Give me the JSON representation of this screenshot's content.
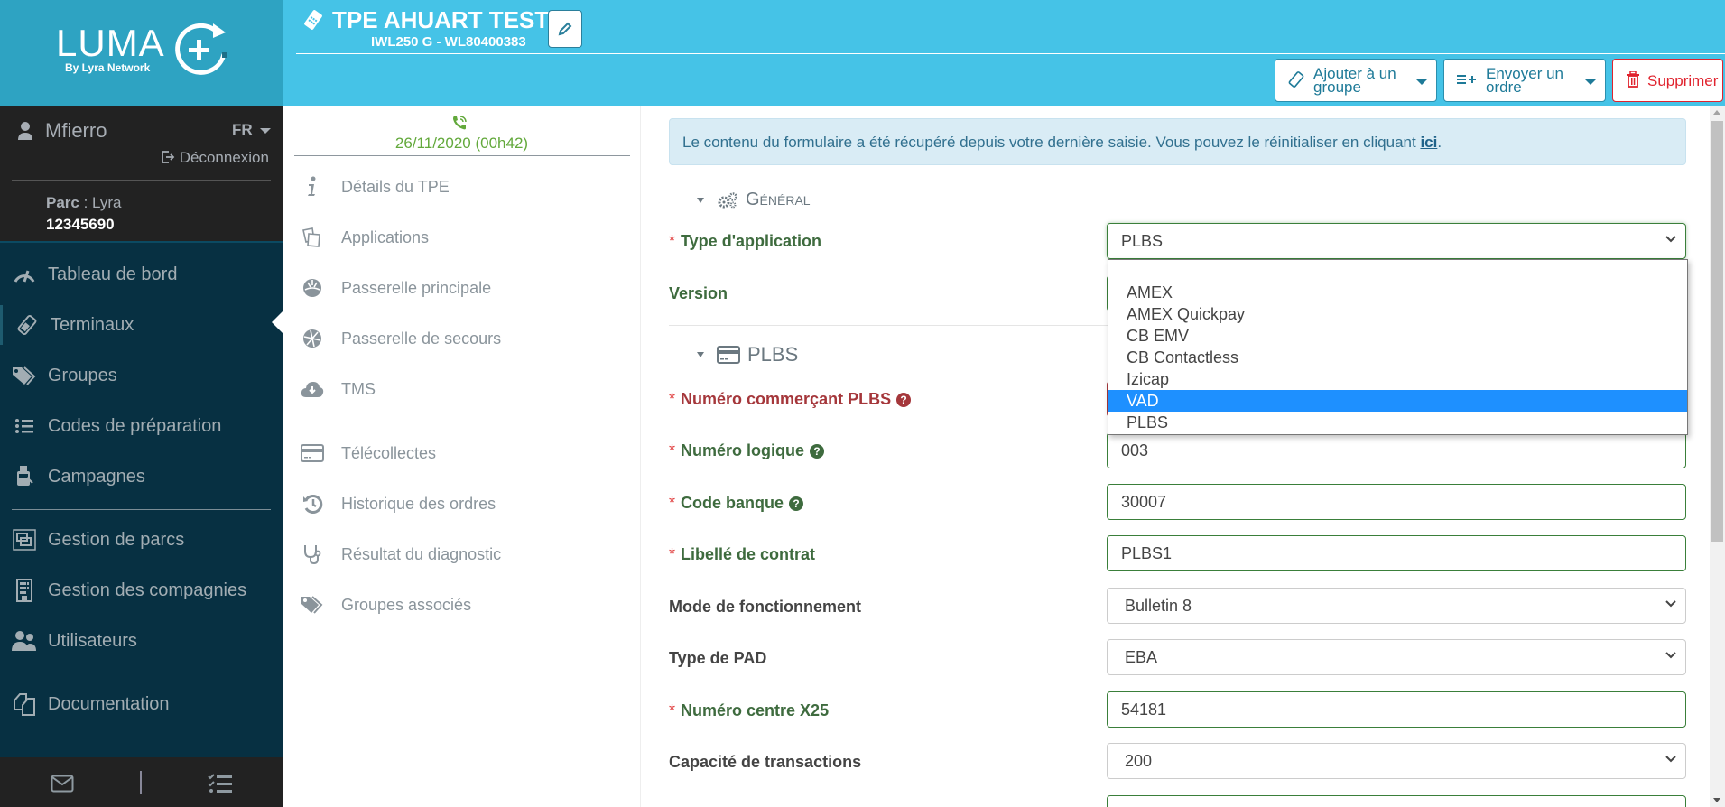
{
  "brand": {
    "name": "LUMA",
    "tagline": "By Lyra Network"
  },
  "user": {
    "name": "Mfierro",
    "language": "FR",
    "logout_label": "Déconnexion",
    "parc_label": "Parc",
    "parc_name": " : Lyra",
    "parc_id": "12345690"
  },
  "sidebar": {
    "items": [
      {
        "label": "Tableau de bord",
        "icon": "dashboard-gauge-icon"
      },
      {
        "label": "Terminaux",
        "icon": "terminal-icon",
        "active": true
      },
      {
        "label": "Groupes",
        "icon": "tags-icon"
      },
      {
        "label": "Codes de préparation",
        "icon": "list-icon"
      },
      {
        "label": "Campagnes",
        "icon": "campaign-icon"
      },
      {
        "label": "Gestion de parcs",
        "icon": "parc-management-icon"
      },
      {
        "label": "Gestion des compagnies",
        "icon": "building-icon"
      },
      {
        "label": "Utilisateurs",
        "icon": "users-icon"
      },
      {
        "label": "Documentation",
        "icon": "documents-icon"
      }
    ],
    "footer": {
      "mail_icon": "envelope-icon",
      "tasks_icon": "task-list-icon"
    }
  },
  "header": {
    "title": "TPE AHUART TEST",
    "subtitle": "IWL250 G - WL80400383",
    "edit_icon": "pencil-icon",
    "actions": {
      "add_group": "Ajouter à un groupe",
      "send_order": "Envoyer un ordre",
      "delete": "Supprimer"
    }
  },
  "tpe_nav": {
    "last_call": "26/11/2020 (00h42)",
    "items": [
      {
        "label": "Détails du TPE",
        "icon": "info-icon"
      },
      {
        "label": "Applications",
        "icon": "applications-icon"
      },
      {
        "label": "Passerelle principale",
        "icon": "gateway-icon"
      },
      {
        "label": "Passerelle de secours",
        "icon": "backup-gateway-icon"
      },
      {
        "label": "TMS",
        "icon": "cloud-download-icon"
      },
      {
        "label": "Télécollectes",
        "icon": "credit-card-icon"
      },
      {
        "label": "Historique des ordres",
        "icon": "history-icon"
      },
      {
        "label": "Résultat du diagnostic",
        "icon": "stethoscope-icon"
      },
      {
        "label": "Groupes associés",
        "icon": "tags-icon"
      }
    ]
  },
  "form": {
    "alert_text": "Le contenu du formulaire a été récupéré depuis votre dernière saisie. Vous pouvez le réinitialiser en cliquant ",
    "alert_link": "ici",
    "alert_end": ".",
    "sections": {
      "general": "Général",
      "plbs": "PLBS"
    },
    "fields": {
      "type_application": {
        "label": "Type d'application",
        "value": "PLBS"
      },
      "version": {
        "label": "Version"
      },
      "numero_commercant": {
        "label": "Numéro commerçant PLBS"
      },
      "numero_logique": {
        "label": "Numéro logique",
        "value": "003"
      },
      "code_banque": {
        "label": "Code banque",
        "value": "30007"
      },
      "libelle_contrat": {
        "label": "Libellé de contrat",
        "value": "PLBS1"
      },
      "mode_fonctionnement": {
        "label": "Mode de fonctionnement",
        "value": "Bulletin 8"
      },
      "type_pad": {
        "label": "Type de PAD",
        "value": "EBA"
      },
      "numero_centre": {
        "label": "Numéro centre X25",
        "value": "54181"
      },
      "capacite": {
        "label": "Capacité de transactions",
        "value": "200"
      }
    },
    "dropdown_options": [
      "",
      "AMEX",
      "AMEX Quickpay",
      "CB EMV",
      "CB Contactless",
      "Izicap",
      "VAD",
      "PLBS"
    ],
    "dropdown_highlighted": "VAD"
  },
  "colors": {
    "header": "#45c3e7",
    "logo_bg": "#2ea3c2",
    "sidebar": "#073042",
    "valid_green": "#3e6b3e",
    "error_red": "#a5373b",
    "highlight": "#1e90ff"
  }
}
